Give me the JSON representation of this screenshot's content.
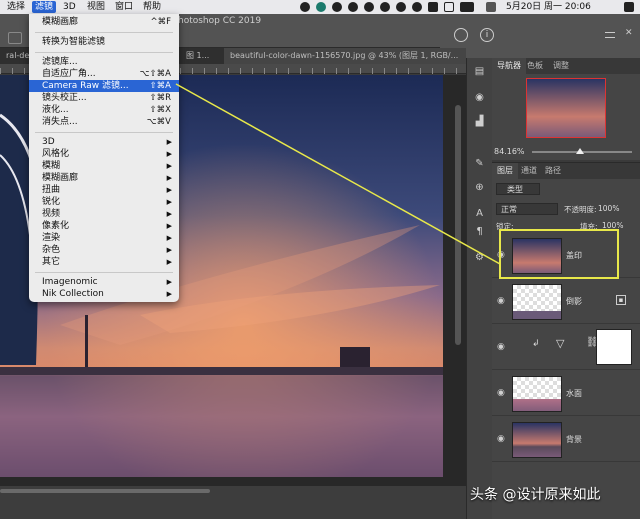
{
  "menubar": {
    "items": [
      "选择",
      "滤镜",
      "3D",
      "视图",
      "窗口",
      "帮助"
    ],
    "active": "滤镜",
    "date_time": "5月20日 周一  20:06"
  },
  "app_title": "hotoshop CC 2019",
  "tabs": [
    {
      "label": "ral-desi"
    },
    {
      "label": "图 1..."
    },
    {
      "label": "beautiful-color-dawn-1156570.jpg @ 43% (图层 1, RGB/..."
    }
  ],
  "filter_menu": {
    "items": [
      {
        "label": "模糊画廊",
        "shortcut": "^⌘F"
      },
      {
        "label": "转换为智能滤镜",
        "shortcut": ""
      },
      {
        "label": "滤镜库...",
        "shortcut": ""
      },
      {
        "label": "自适应广角...",
        "shortcut": "⌥⇧⌘A"
      },
      {
        "label": "Camera Raw 滤镜...",
        "shortcut": "⇧⌘A"
      },
      {
        "label": "镜头校正...",
        "shortcut": "⇧⌘R"
      },
      {
        "label": "液化...",
        "shortcut": "⇧⌘X"
      },
      {
        "label": "消失点...",
        "shortcut": "⌥⌘V"
      },
      {
        "label": "3D",
        "shortcut": ""
      },
      {
        "label": "风格化",
        "shortcut": ""
      },
      {
        "label": "模糊",
        "shortcut": ""
      },
      {
        "label": "模糊画廊",
        "shortcut": ""
      },
      {
        "label": "扭曲",
        "shortcut": ""
      },
      {
        "label": "锐化",
        "shortcut": ""
      },
      {
        "label": "视频",
        "shortcut": ""
      },
      {
        "label": "像素化",
        "shortcut": ""
      },
      {
        "label": "渲染",
        "shortcut": ""
      },
      {
        "label": "杂色",
        "shortcut": ""
      },
      {
        "label": "其它",
        "shortcut": ""
      },
      {
        "label": "Imagenomic",
        "shortcut": ""
      },
      {
        "label": "Nik Collection",
        "shortcut": ""
      }
    ],
    "highlighted": "Camera Raw 滤镜..."
  },
  "navigator": {
    "tabs": [
      "导航器",
      "色板",
      "调整"
    ],
    "zoom": "84.16%"
  },
  "layers_panel": {
    "tabs": [
      "图层",
      "通道",
      "路径"
    ],
    "filter_kind": "类型",
    "blend_mode": "正常",
    "opacity_label": "不透明度:",
    "opacity_value": "100%",
    "lock_label": "锁定:",
    "fill_label": "填充:",
    "fill_value": "100%",
    "layers": [
      {
        "name": "盖印",
        "selected": true
      },
      {
        "name": "倒影",
        "selected": false
      },
      {
        "name": "",
        "selected": false
      },
      {
        "name": "水面",
        "selected": false
      },
      {
        "name": "背景",
        "selected": false
      }
    ]
  },
  "watermark": "头条 @设计原来如此",
  "colors": {
    "menu_highlight": "#2a65d4",
    "callout_yellow": "#e8e84a"
  }
}
